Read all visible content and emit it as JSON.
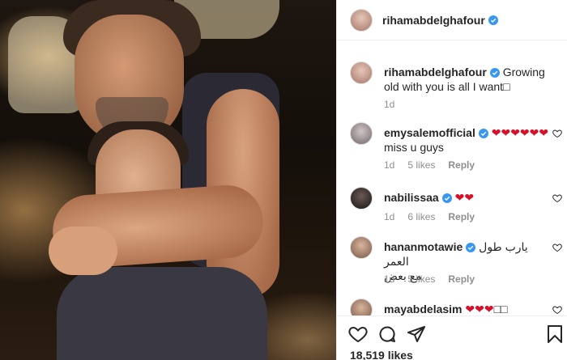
{
  "post": {
    "author": "rihamabdelghafour",
    "caption": "Growing old with you is all I want",
    "caption_emoji": "□",
    "caption_time": "1d",
    "likes": "18,519 likes"
  },
  "comments": [
    {
      "username": "emysalemofficial",
      "text": "❤❤❤❤❤❤",
      "text2": "miss u guys",
      "time": "1d",
      "likes": "5 likes",
      "reply": "Reply"
    },
    {
      "username": "nabilissaa",
      "text": "❤❤",
      "time": "1d",
      "likes": "6 likes",
      "reply": "Reply"
    },
    {
      "username": "hananmotawie",
      "text": "يارب طول العمر",
      "text2": "مع بعض",
      "time": "1d",
      "likes": "5 likes",
      "reply": "Reply"
    },
    {
      "username": "mayabdelasim",
      "text": "❤❤❤",
      "text_suffix": "□□"
    }
  ],
  "colors": {
    "verified_blue": "#3897f0",
    "heart_red": "#d6102a",
    "meta_gray": "#8e8e8e"
  }
}
